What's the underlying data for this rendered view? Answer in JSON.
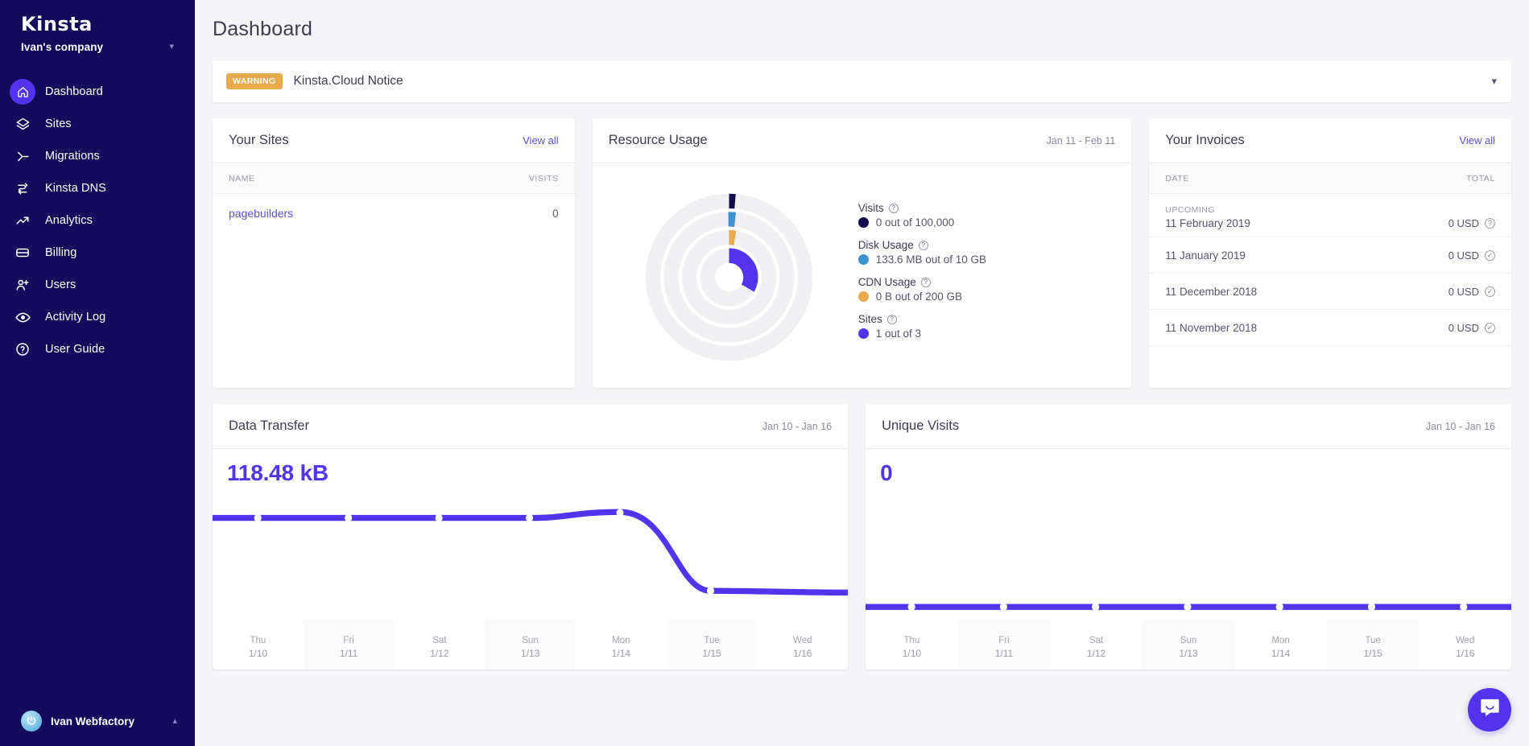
{
  "sidebar": {
    "logo": "Kinsta",
    "company": "Ivan's company",
    "company_chevron": "chevron-down",
    "items": [
      {
        "label": "Dashboard",
        "icon": "home-icon",
        "active": true
      },
      {
        "label": "Sites",
        "icon": "layers-icon",
        "active": false
      },
      {
        "label": "Migrations",
        "icon": "migration-arrow-icon",
        "active": false
      },
      {
        "label": "Kinsta DNS",
        "icon": "dns-shuffle-icon",
        "active": false
      },
      {
        "label": "Analytics",
        "icon": "trending-up-icon",
        "active": false
      },
      {
        "label": "Billing",
        "icon": "credit-card-icon",
        "active": false
      },
      {
        "label": "Users",
        "icon": "user-plus-icon",
        "active": false
      },
      {
        "label": "Activity Log",
        "icon": "eye-icon",
        "active": false
      },
      {
        "label": "User Guide",
        "icon": "question-circle-icon",
        "active": false
      }
    ],
    "footer": {
      "user": "Ivan Webfactory",
      "chevron": "chevron-up"
    }
  },
  "header": {
    "title": "Dashboard"
  },
  "notice": {
    "badge": "WARNING",
    "title": "Kinsta.Cloud Notice",
    "badge_color": "#e8a84c",
    "expand_icon": "chevron-down-icon"
  },
  "your_sites": {
    "title": "Your Sites",
    "view_all": "View all",
    "columns": {
      "name": "NAME",
      "visits": "VISITS"
    },
    "rows": [
      {
        "name": "pagebuilders",
        "visits": "0"
      }
    ]
  },
  "resource_usage": {
    "title": "Resource Usage",
    "range": "Jan 11 - Feb 11",
    "legend": [
      {
        "name": "Visits",
        "value": "0 out of 100,000",
        "color": "#120a4f",
        "fraction": 0.0
      },
      {
        "name": "Disk Usage",
        "value": "133.6 MB out of 10 GB",
        "color": "#3d91cf",
        "fraction": 0.013
      },
      {
        "name": "CDN Usage",
        "value": "0 B out of 200 GB",
        "color": "#e8a84c",
        "fraction": 0.0
      },
      {
        "name": "Sites",
        "value": "1 out of 3",
        "color": "#5333ed",
        "fraction": 0.3333
      }
    ],
    "help_icon": "question-circle-icon",
    "track_color": "#f0f0f2"
  },
  "your_invoices": {
    "title": "Your Invoices",
    "view_all": "View all",
    "columns": {
      "date": "DATE",
      "total": "TOTAL"
    },
    "upcoming_label": "UPCOMING",
    "rows": [
      {
        "date": "11 February 2019",
        "total": "0 USD",
        "status_icon": "question-circle-icon",
        "upcoming": true
      },
      {
        "date": "11 January 2019",
        "total": "0 USD",
        "status_icon": "check-circle-icon",
        "upcoming": false
      },
      {
        "date": "11 December 2018",
        "total": "0 USD",
        "status_icon": "check-circle-icon",
        "upcoming": false
      },
      {
        "date": "11 November 2018",
        "total": "0 USD",
        "status_icon": "check-circle-icon",
        "upcoming": false
      }
    ]
  },
  "chart_data": [
    {
      "type": "line",
      "title": "Data Transfer",
      "range": "Jan 10 - Jan 16",
      "summary_value": "118.48 kB",
      "line_color": "#5333ed",
      "xlabel": "",
      "ylabel": "",
      "categories": [
        "Thu",
        "Fri",
        "Sat",
        "Sun",
        "Mon",
        "Tue",
        "Wed"
      ],
      "tick_dates": [
        "1/10",
        "1/11",
        "1/12",
        "1/13",
        "1/14",
        "1/15",
        "1/16"
      ],
      "values": [
        100,
        100,
        100,
        100,
        100,
        100,
        12
      ],
      "ylim": [
        0,
        110
      ],
      "grid": false,
      "legend": "none"
    },
    {
      "type": "line",
      "title": "Unique Visits",
      "range": "Jan 10 - Jan 16",
      "summary_value": "0",
      "line_color": "#5333ed",
      "xlabel": "",
      "ylabel": "",
      "categories": [
        "Thu",
        "Fri",
        "Sat",
        "Sun",
        "Mon",
        "Tue",
        "Wed"
      ],
      "tick_dates": [
        "1/10",
        "1/11",
        "1/12",
        "1/13",
        "1/14",
        "1/15",
        "1/16"
      ],
      "values": [
        0,
        0,
        0,
        0,
        0,
        0,
        0
      ],
      "ylim": [
        0,
        10
      ],
      "grid": false,
      "legend": "none"
    }
  ],
  "intercom": {
    "icon": "chat-smile-icon",
    "color": "#5333ed"
  }
}
